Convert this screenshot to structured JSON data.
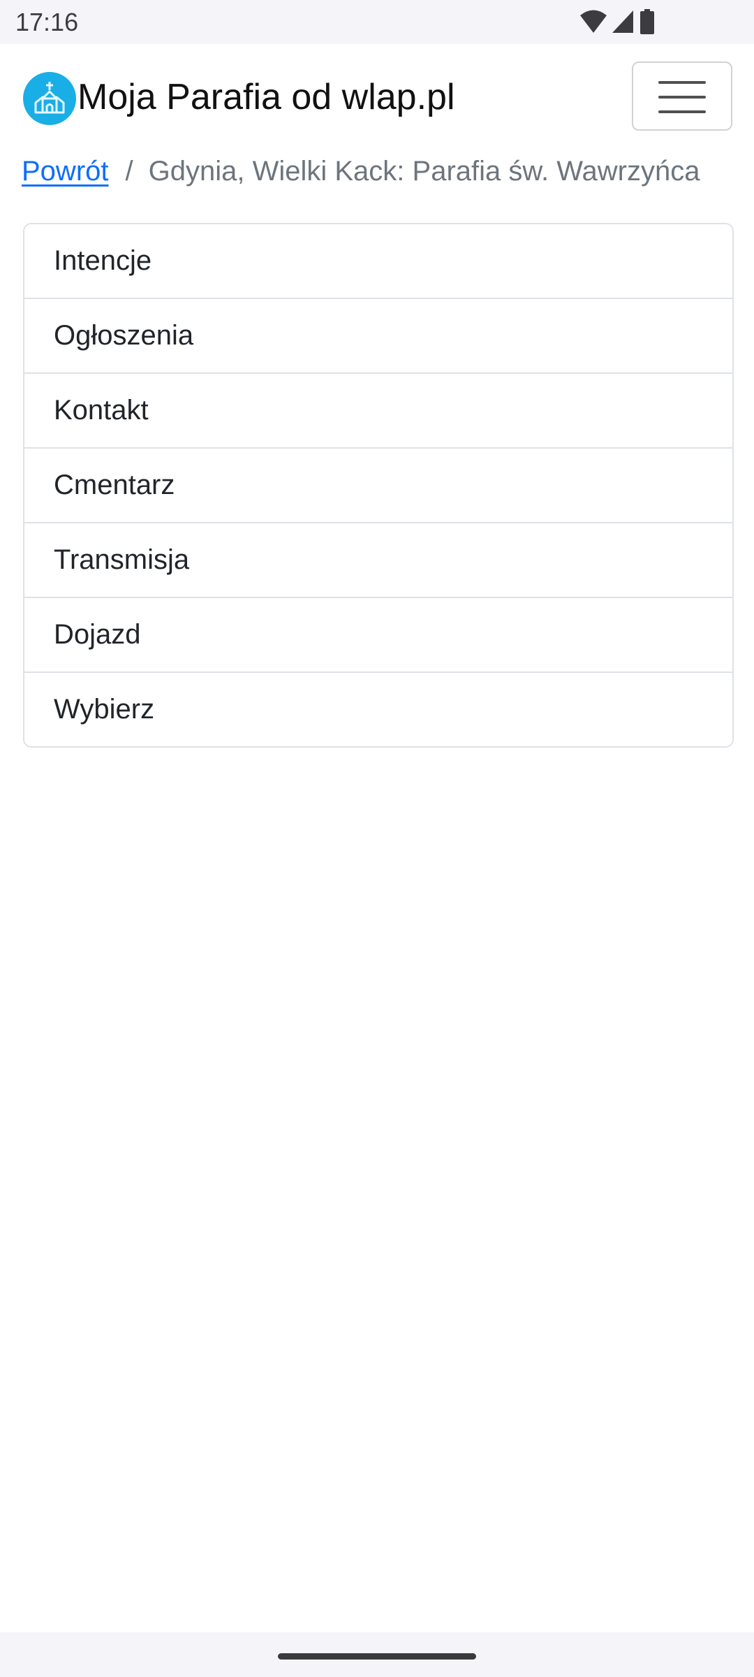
{
  "status_bar": {
    "time": "17:16",
    "icons": [
      "wifi-icon",
      "signal-icon",
      "battery-icon"
    ]
  },
  "header": {
    "logo": "church-logo-icon",
    "title": "Moja Parafia od wlap.pl",
    "menu_icon": "hamburger-menu-icon"
  },
  "breadcrumb": {
    "back_label": "Powrót",
    "separator": "/",
    "current": "Gdynia, Wielki Kack: Parafia św. Wawrzyńca"
  },
  "menu": {
    "items": [
      {
        "label": "Intencje"
      },
      {
        "label": "Ogłoszenia"
      },
      {
        "label": "Kontakt"
      },
      {
        "label": "Cmentarz"
      },
      {
        "label": "Transmisja"
      },
      {
        "label": "Dojazd"
      },
      {
        "label": "Wybierz"
      }
    ]
  },
  "colors": {
    "link": "#0d6efd",
    "logo_bg": "#1aaee6",
    "border": "#dee2e6",
    "muted_text": "#6c757d"
  }
}
